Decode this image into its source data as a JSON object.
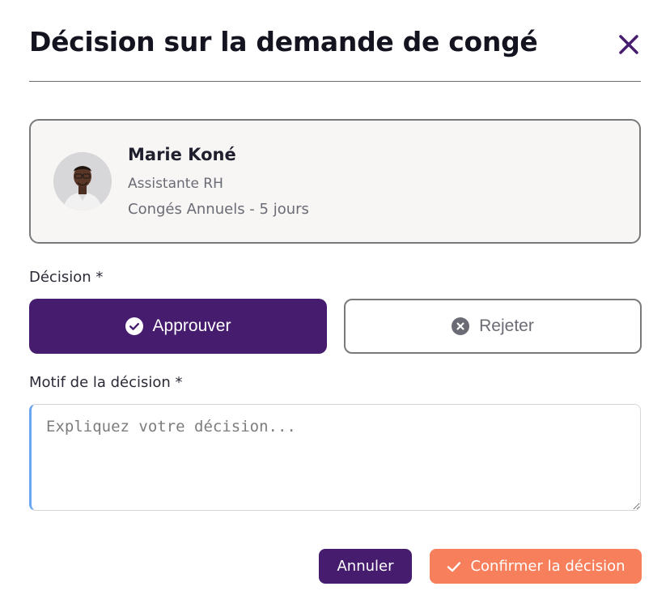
{
  "dialog": {
    "title": "Décision sur la demande de congé",
    "close_icon": "close-icon"
  },
  "employee": {
    "name": "Marie Koné",
    "role": "Assistante RH",
    "leave": "Congés Annuels - 5 jours",
    "avatar_icon": "avatar-photo"
  },
  "decision": {
    "label": "Décision *",
    "approve_label": "Approuver",
    "approve_icon": "check-circle-icon",
    "reject_label": "Rejeter",
    "reject_icon": "x-circle-icon",
    "selected": "Approuver"
  },
  "motif": {
    "label": "Motif de la décision *",
    "placeholder": "Expliquez votre décision...",
    "value": ""
  },
  "actions": {
    "cancel_label": "Annuler",
    "confirm_label": "Confirmer la décision",
    "confirm_icon": "check-icon"
  },
  "colors": {
    "primary": "#461d6e",
    "accent": "#f77f5b",
    "focus": "#6aa6f0"
  }
}
